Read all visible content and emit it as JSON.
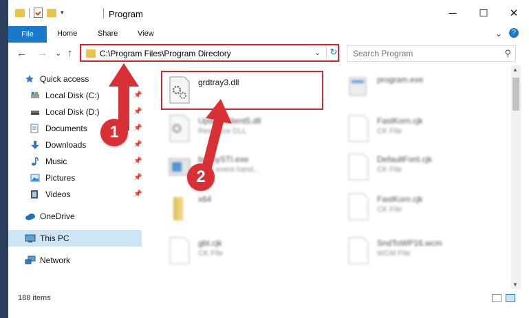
{
  "window": {
    "title": "Program",
    "controls": {
      "minimize": "─",
      "maximize": "☐",
      "close": "✕"
    }
  },
  "ribbon": {
    "file": "File",
    "tabs": [
      "Home",
      "Share",
      "View"
    ],
    "expand": "⌄",
    "help": "?"
  },
  "nav": {
    "back": "←",
    "forward": "→",
    "recent": "⌄",
    "up": "↑",
    "address": "C:\\Program Files\\Program Directory",
    "address_dropdown": "⌄",
    "refresh": "↻",
    "search_placeholder": "Search Program",
    "search_icon": "⚲"
  },
  "sidebar": {
    "items": [
      {
        "label": "Quick access",
        "icon": "star-icon"
      },
      {
        "label": "Local Disk (C:)",
        "icon": "drive-icon",
        "pinned": true
      },
      {
        "label": "Local Disk (D:)",
        "icon": "drive-icon",
        "pinned": true
      },
      {
        "label": "Documents",
        "icon": "documents-icon",
        "pinned": true
      },
      {
        "label": "Downloads",
        "icon": "download-icon",
        "pinned": true
      },
      {
        "label": "Music",
        "icon": "music-icon",
        "pinned": true
      },
      {
        "label": "Pictures",
        "icon": "pictures-icon",
        "pinned": true
      },
      {
        "label": "Videos",
        "icon": "videos-icon",
        "pinned": true
      },
      {
        "label": "OneDrive",
        "icon": "cloud-icon"
      },
      {
        "label": "This PC",
        "icon": "computer-icon",
        "selected": true
      },
      {
        "label": "Network",
        "icon": "network-icon"
      }
    ]
  },
  "files": [
    {
      "name": "grdtray3.dll",
      "type": "",
      "icon": "dll-gear-icon"
    },
    {
      "name": "program.exe",
      "type": "",
      "icon": "exe-icon"
    },
    {
      "name": "UpdateClient5.dll",
      "type": "Resource DLL",
      "icon": "dll-gear-icon"
    },
    {
      "name": "FastKorn.cjk",
      "type": "CK File",
      "icon": "blank-file-icon"
    },
    {
      "name": "busbySTI.exe",
      "type": "Ul ot event hand...",
      "icon": "exe-window-icon"
    },
    {
      "name": "DefaultFont.cjk",
      "type": "CK File",
      "icon": "blank-file-icon"
    },
    {
      "name": "x64",
      "type": "",
      "icon": "folder-icon"
    },
    {
      "name": "FastKorn.cjk",
      "type": "CK File",
      "icon": "blank-file-icon"
    },
    {
      "name": "gbt.cjk",
      "type": "CK File",
      "icon": "blank-file-icon"
    },
    {
      "name": "SndToWP16.wcm",
      "type": "WCM File",
      "icon": "blank-file-icon"
    }
  ],
  "status": {
    "count": "188 items"
  },
  "annotations": {
    "step1": "1",
    "step2": "2",
    "highlight_color": "#d9232e"
  }
}
